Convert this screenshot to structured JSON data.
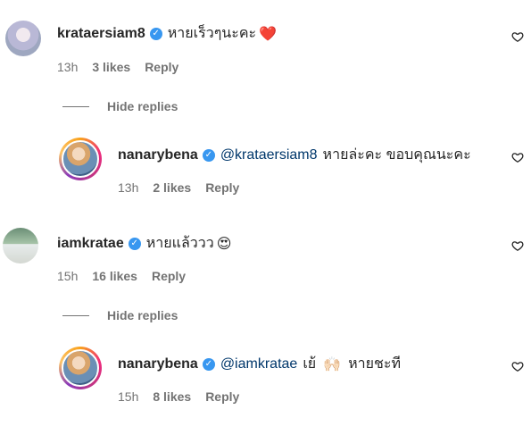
{
  "comments": [
    {
      "username": "krataersiam8",
      "text": "หายเร็วๆนะคะ",
      "emoji": "❤️",
      "time": "13h",
      "likes": "3 likes",
      "reply": "Reply"
    },
    {
      "username": "nanarybena",
      "mention": "@krataersiam8",
      "text": "หายล่ะคะ ขอบคุณนะคะ",
      "time": "13h",
      "likes": "2 likes",
      "reply": "Reply"
    },
    {
      "username": "iamkratae",
      "text": "หายแล้ววว",
      "emoji": "😍",
      "time": "15h",
      "likes": "16 likes",
      "reply": "Reply"
    },
    {
      "username": "nanarybena",
      "mention": "@iamkratae",
      "text": "เย้",
      "emoji": "🙌🏻",
      "text2": "หายชะที",
      "time": "15h",
      "likes": "8 likes",
      "reply": "Reply"
    }
  ],
  "hide_replies": "Hide replies",
  "icons": {
    "like": "heart-outline-icon",
    "verified": "verified-badge-icon"
  },
  "colors": {
    "verified": "#3897f0",
    "mention": "#00376b",
    "meta": "#737373"
  }
}
